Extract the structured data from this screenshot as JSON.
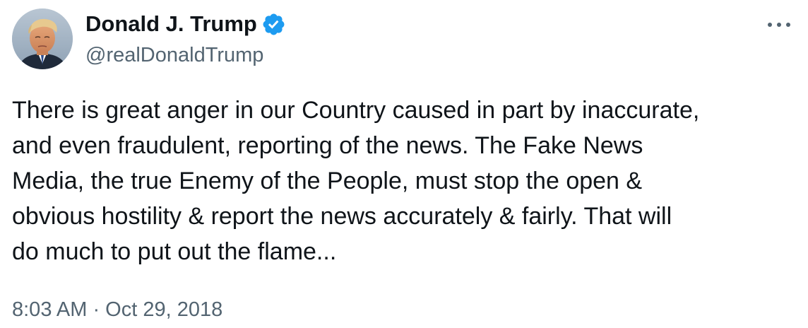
{
  "author": {
    "display_name": "Donald J. Trump",
    "handle": "@realDonaldTrump",
    "verified": true,
    "avatar_icon": "profile-photo"
  },
  "menu": {
    "icon": "more-horizontal-icon"
  },
  "tweet": {
    "lines": [
      "There is great anger in our Country caused in part by inaccurate,",
      "and even fraudulent, reporting of the news. The Fake News",
      "Media, the true Enemy of the People, must stop the open &",
      "obvious hostility & report the news accurately & fairly. That will",
      "do much to put out the flame..."
    ],
    "timestamp": "8:03 AM · Oct 29, 2018"
  },
  "colors": {
    "text_primary": "#0f1419",
    "text_secondary": "#536471",
    "verified_blue": "#1d9bf0",
    "background": "#ffffff"
  }
}
